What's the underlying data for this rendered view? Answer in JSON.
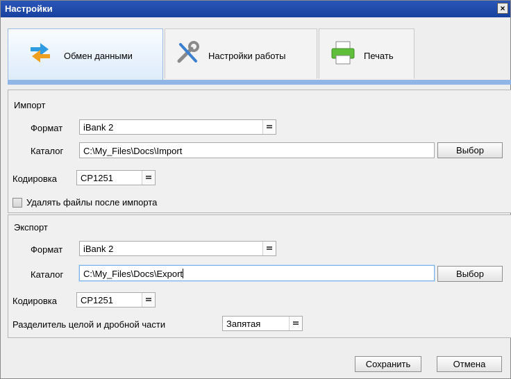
{
  "window": {
    "title": "Настройки",
    "close_label": "×"
  },
  "tabs": [
    {
      "label": "Обмен данными",
      "icon": "exchange-arrows-icon",
      "active": true
    },
    {
      "label": "Настройки работы",
      "icon": "wrench-screwdriver-icon",
      "active": false
    },
    {
      "label": "Печать",
      "icon": "printer-icon",
      "active": false
    }
  ],
  "import": {
    "section_title": "Импорт",
    "format_label": "Формат",
    "format_value": "iBank 2",
    "catalog_label": "Каталог",
    "catalog_value": "C:\\My_Files\\Docs\\Import",
    "browse_label": "Выбор",
    "encoding_label": "Кодировка",
    "encoding_value": "CP1251",
    "delete_files_label": "Удалять файлы после импорта",
    "delete_files_checked": false
  },
  "export": {
    "section_title": "Экспорт",
    "format_label": "Формат",
    "format_value": "iBank 2",
    "catalog_label": "Каталог",
    "catalog_value": "C:\\My_Files\\Docs\\Export",
    "browse_label": "Выбор",
    "encoding_label": "Кодировка",
    "encoding_value": "CP1251",
    "separator_label": "Разделитель целой и дробной части",
    "separator_value": "Запятая"
  },
  "footer": {
    "save_label": "Сохранить",
    "cancel_label": "Отмена"
  },
  "colors": {
    "titlebar": "#1f4cae",
    "tab_active": "#dcebfa",
    "tab_underline": "#8fb6e6"
  }
}
